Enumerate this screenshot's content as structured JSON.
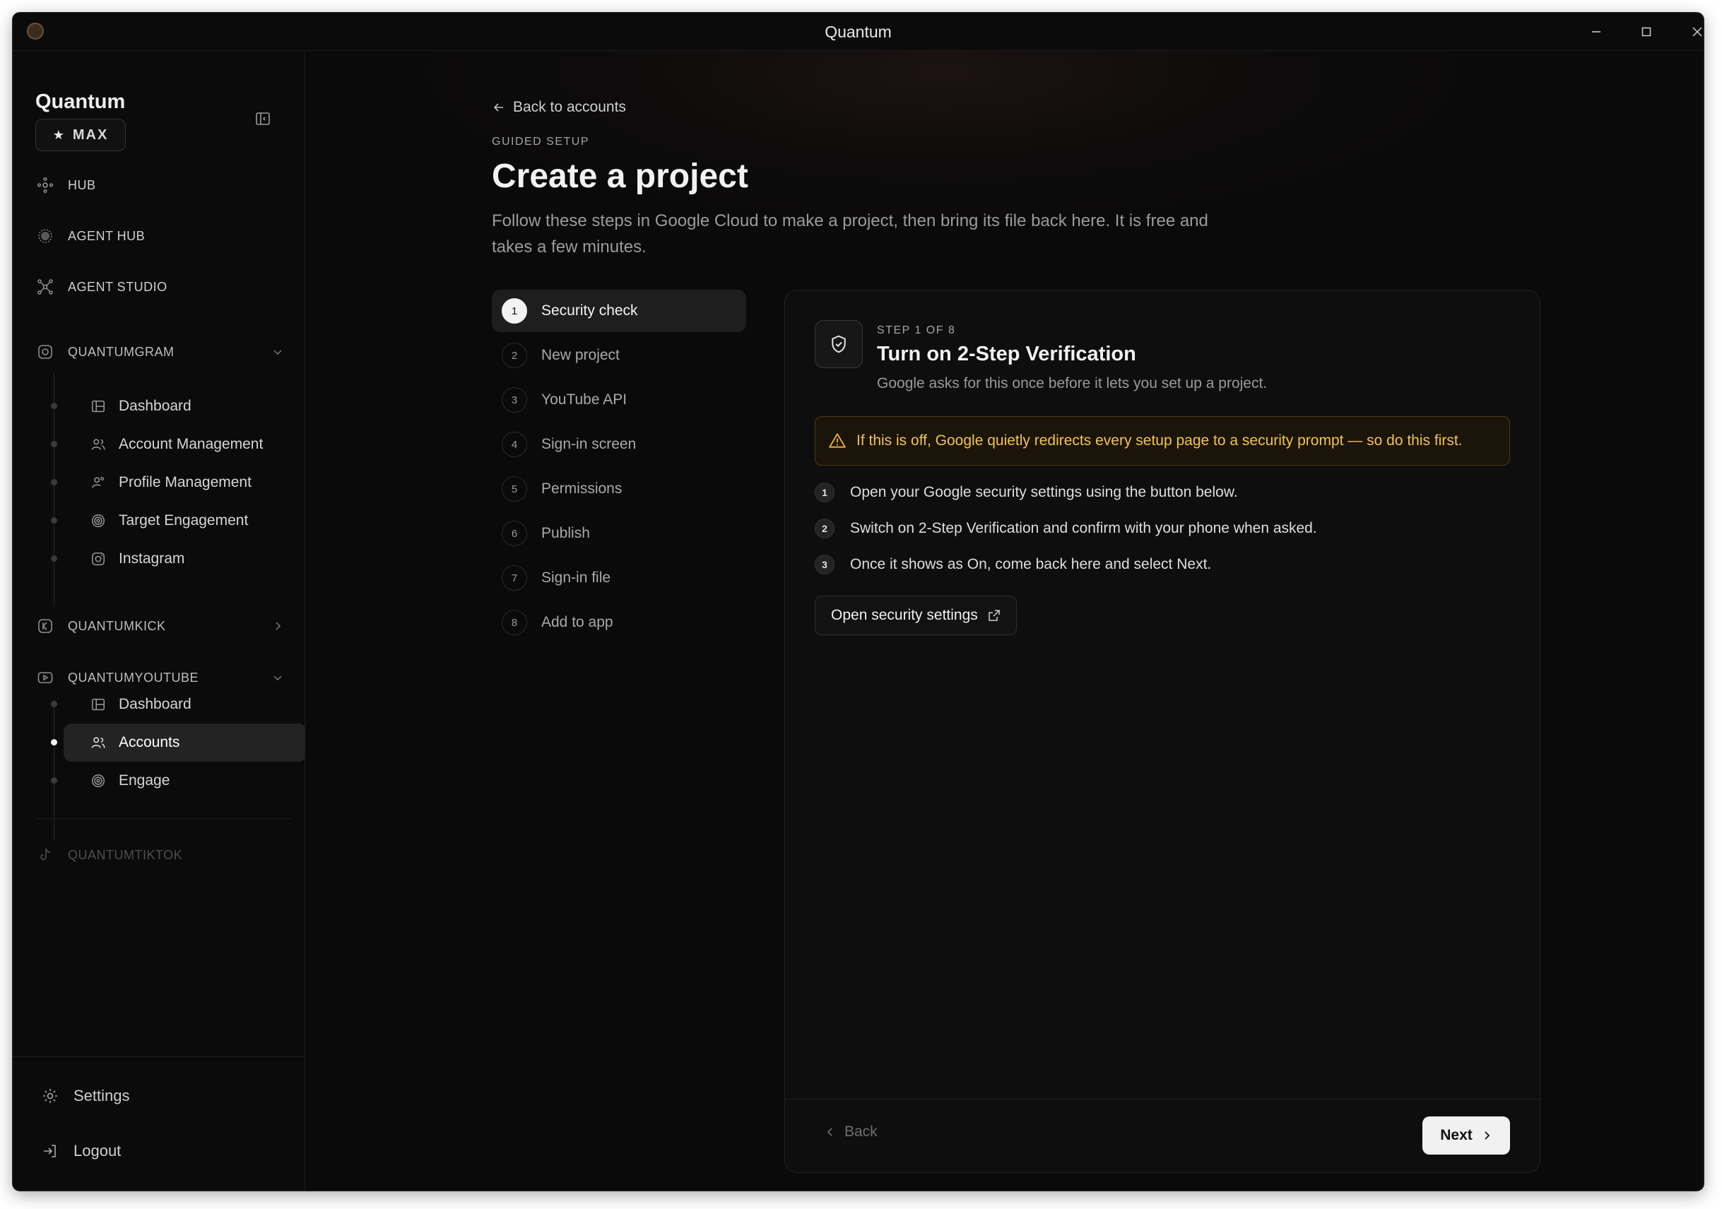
{
  "window": {
    "title": "Quantum"
  },
  "sidebar": {
    "brand": "Quantum",
    "plan_badge": "MAX",
    "top_items": [
      {
        "label": "HUB",
        "icon": "hub-icon"
      },
      {
        "label": "AGENT HUB",
        "icon": "agent-hub-icon"
      },
      {
        "label": "AGENT STUDIO",
        "icon": "agent-studio-icon"
      }
    ],
    "groups": {
      "quantumgram": {
        "label": "QUANTUMGRAM",
        "items": [
          "Dashboard",
          "Account Management",
          "Profile Management",
          "Target Engagement",
          "Instagram"
        ]
      },
      "quantumkick": {
        "label": "QUANTUMKICK"
      },
      "quantumyoutube": {
        "label": "QUANTUMYOUTUBE",
        "items": [
          "Dashboard",
          "Accounts",
          "Engage"
        ],
        "active_item": "Accounts"
      },
      "quantumtiktok": {
        "label": "QUANTUMTIKTOK",
        "disabled": true
      }
    },
    "footer": {
      "settings": "Settings",
      "logout": "Logout"
    }
  },
  "main": {
    "back_link": "Back to accounts",
    "eyebrow": "GUIDED SETUP",
    "title": "Create a project",
    "description": "Follow these steps in Google Cloud to make a project, then bring its file back here. It is free and takes a few minutes.",
    "steps": [
      {
        "num": "1",
        "label": "Security check",
        "active": true
      },
      {
        "num": "2",
        "label": "New project"
      },
      {
        "num": "3",
        "label": "YouTube API"
      },
      {
        "num": "4",
        "label": "Sign-in screen"
      },
      {
        "num": "5",
        "label": "Permissions"
      },
      {
        "num": "6",
        "label": "Publish"
      },
      {
        "num": "7",
        "label": "Sign-in file"
      },
      {
        "num": "8",
        "label": "Add to app"
      }
    ],
    "card": {
      "eyebrow": "STEP 1 OF 8",
      "title": "Turn on 2-Step Verification",
      "subtitle": "Google asks for this once before it lets you set up a project.",
      "warning": "If this is off, Google quietly redirects every setup page to a security prompt — so do this first.",
      "instructions": [
        {
          "num": "1",
          "text": "Open your Google security settings using the button below."
        },
        {
          "num": "2",
          "text": "Switch on 2-Step Verification and confirm with your phone when asked."
        },
        {
          "num": "3",
          "text": "Once it shows as On, come back here and select Next."
        }
      ],
      "open_button": "Open security settings",
      "back_button": "Back",
      "next_button": "Next"
    }
  },
  "colors": {
    "background": "#0a0a0a",
    "warning_text": "#f1c451",
    "warning_bg": "#1b1408",
    "active_item_bg": "#232323"
  }
}
